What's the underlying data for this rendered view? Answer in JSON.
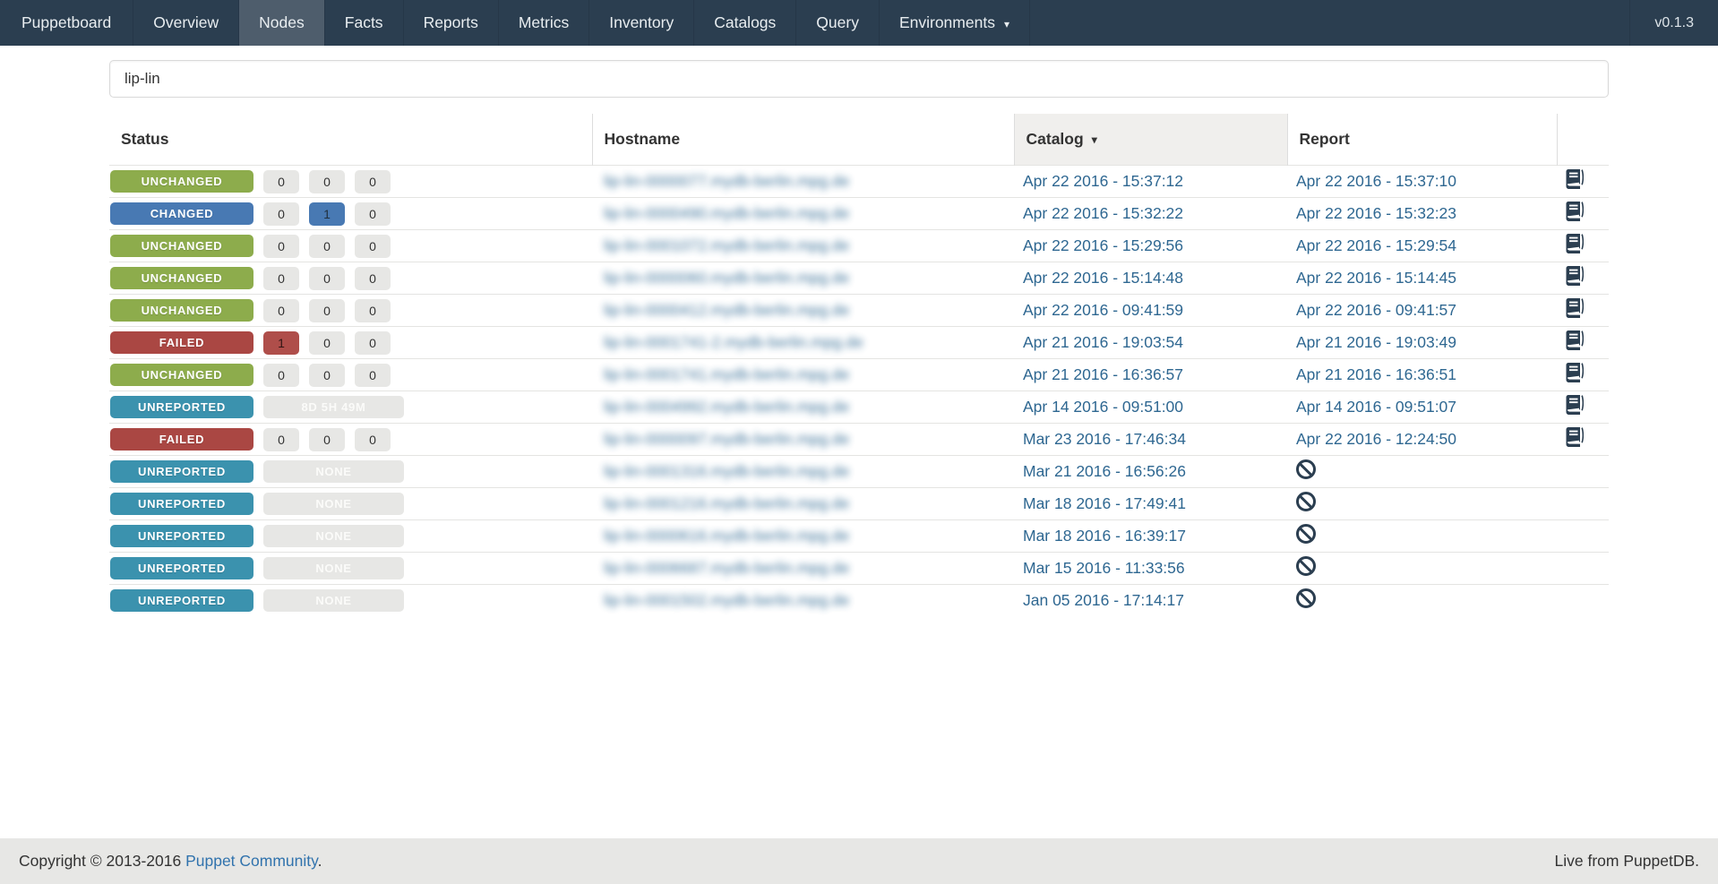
{
  "navbar": {
    "brand": "Puppetboard",
    "items": [
      {
        "label": "Overview",
        "active": false,
        "dropdown": false
      },
      {
        "label": "Nodes",
        "active": true,
        "dropdown": false
      },
      {
        "label": "Facts",
        "active": false,
        "dropdown": false
      },
      {
        "label": "Reports",
        "active": false,
        "dropdown": false
      },
      {
        "label": "Metrics",
        "active": false,
        "dropdown": false
      },
      {
        "label": "Inventory",
        "active": false,
        "dropdown": false
      },
      {
        "label": "Catalogs",
        "active": false,
        "dropdown": false
      },
      {
        "label": "Query",
        "active": false,
        "dropdown": false
      },
      {
        "label": "Environments",
        "active": false,
        "dropdown": true
      }
    ],
    "version": "v0.1.3"
  },
  "icons": {
    "dropdown_caret": "▾",
    "sort_caret": "▾"
  },
  "search": {
    "value": "lip-lin"
  },
  "table": {
    "headers": {
      "status": "Status",
      "hostname": "Hostname",
      "catalog": "Catalog",
      "report": "Report"
    },
    "sorted_column": "catalog",
    "sort_direction": "desc",
    "hostnames_blurred": true,
    "rows": [
      {
        "status": "UNCHANGED",
        "variant": "green",
        "counts": [
          {
            "v": "0",
            "hl": ""
          },
          {
            "v": "0",
            "hl": ""
          },
          {
            "v": "0",
            "hl": ""
          }
        ],
        "hostname": "lip-lin-0000077.mydb-berlin.mpg.de",
        "catalog": "Apr 22 2016 - 15:37:12",
        "report": "Apr 22 2016 - 15:37:10",
        "report_icon": "book"
      },
      {
        "status": "CHANGED",
        "variant": "blue",
        "counts": [
          {
            "v": "0",
            "hl": ""
          },
          {
            "v": "1",
            "hl": "hl-blue"
          },
          {
            "v": "0",
            "hl": ""
          }
        ],
        "hostname": "lip-lin-0000490.mydb-berlin.mpg.de",
        "catalog": "Apr 22 2016 - 15:32:22",
        "report": "Apr 22 2016 - 15:32:23",
        "report_icon": "book"
      },
      {
        "status": "UNCHANGED",
        "variant": "green",
        "counts": [
          {
            "v": "0",
            "hl": ""
          },
          {
            "v": "0",
            "hl": ""
          },
          {
            "v": "0",
            "hl": ""
          }
        ],
        "hostname": "lip-lin-0001072.mydb-berlin.mpg.de",
        "catalog": "Apr 22 2016 - 15:29:56",
        "report": "Apr 22 2016 - 15:29:54",
        "report_icon": "book"
      },
      {
        "status": "UNCHANGED",
        "variant": "green",
        "counts": [
          {
            "v": "0",
            "hl": ""
          },
          {
            "v": "0",
            "hl": ""
          },
          {
            "v": "0",
            "hl": ""
          }
        ],
        "hostname": "lip-lin-0000060.mydb-berlin.mpg.de",
        "catalog": "Apr 22 2016 - 15:14:48",
        "report": "Apr 22 2016 - 15:14:45",
        "report_icon": "book"
      },
      {
        "status": "UNCHANGED",
        "variant": "green",
        "counts": [
          {
            "v": "0",
            "hl": ""
          },
          {
            "v": "0",
            "hl": ""
          },
          {
            "v": "0",
            "hl": ""
          }
        ],
        "hostname": "lip-lin-0000412.mydb-berlin.mpg.de",
        "catalog": "Apr 22 2016 - 09:41:59",
        "report": "Apr 22 2016 - 09:41:57",
        "report_icon": "book"
      },
      {
        "status": "FAILED",
        "variant": "red",
        "counts": [
          {
            "v": "1",
            "hl": "hl-red"
          },
          {
            "v": "0",
            "hl": ""
          },
          {
            "v": "0",
            "hl": ""
          }
        ],
        "hostname": "lip-lin-0001741-2.mydb-berlin.mpg.de",
        "catalog": "Apr 21 2016 - 19:03:54",
        "report": "Apr 21 2016 - 19:03:49",
        "report_icon": "book"
      },
      {
        "status": "UNCHANGED",
        "variant": "green",
        "counts": [
          {
            "v": "0",
            "hl": ""
          },
          {
            "v": "0",
            "hl": ""
          },
          {
            "v": "0",
            "hl": ""
          }
        ],
        "hostname": "lip-lin-0001741.mydb-berlin.mpg.de",
        "catalog": "Apr 21 2016 - 16:36:57",
        "report": "Apr 21 2016 - 16:36:51",
        "report_icon": "book"
      },
      {
        "status": "UNREPORTED",
        "variant": "teal",
        "wide": "8D 5H 49M",
        "hostname": "lip-lin-0004992.mydb-berlin.mpg.de",
        "catalog": "Apr 14 2016 - 09:51:00",
        "report": "Apr 14 2016 - 09:51:07",
        "report_icon": "book"
      },
      {
        "status": "FAILED",
        "variant": "red",
        "counts": [
          {
            "v": "0",
            "hl": ""
          },
          {
            "v": "0",
            "hl": ""
          },
          {
            "v": "0",
            "hl": ""
          }
        ],
        "hostname": "lip-lin-0000097.mydb-berlin.mpg.de",
        "catalog": "Mar 23 2016 - 17:46:34",
        "report": "Apr 22 2016 - 12:24:50",
        "report_icon": "book"
      },
      {
        "status": "UNREPORTED",
        "variant": "teal",
        "wide": "NONE",
        "hostname": "lip-lin-0001316.mydb-berlin.mpg.de",
        "catalog": "Mar 21 2016 - 16:56:26",
        "report": "",
        "report_icon": "ban"
      },
      {
        "status": "UNREPORTED",
        "variant": "teal",
        "wide": "NONE",
        "hostname": "lip-lin-0001216.mydb-berlin.mpg.de",
        "catalog": "Mar 18 2016 - 17:49:41",
        "report": "",
        "report_icon": "ban"
      },
      {
        "status": "UNREPORTED",
        "variant": "teal",
        "wide": "NONE",
        "hostname": "lip-lin-0000616.mydb-berlin.mpg.de",
        "catalog": "Mar 18 2016 - 16:39:17",
        "report": "",
        "report_icon": "ban"
      },
      {
        "status": "UNREPORTED",
        "variant": "teal",
        "wide": "NONE",
        "hostname": "lip-lin-0006687.mydb-berlin.mpg.de",
        "catalog": "Mar 15 2016 - 11:33:56",
        "report": "",
        "report_icon": "ban"
      },
      {
        "status": "UNREPORTED",
        "variant": "teal",
        "wide": "NONE",
        "hostname": "lip-lin-0001502.mydb-berlin.mpg.de",
        "catalog": "Jan 05 2016 - 17:14:17",
        "report": "",
        "report_icon": "ban"
      }
    ]
  },
  "footer": {
    "copyright_prefix": "Copyright © 2013-2016 ",
    "community_link": "Puppet Community",
    "copyright_suffix": ".",
    "live_text": "Live from PuppetDB."
  },
  "colors": {
    "navbar_bg": "#2b3e50",
    "navbar_active_bg": "#4e5d6c",
    "badge_unchanged": "#8dac4c",
    "badge_changed": "#4879b3",
    "badge_failed": "#aa4743",
    "badge_unreported": "#3b92ae",
    "count_bg": "#e7e7e5",
    "link": "#2e6791",
    "footer_bg": "#e7e7e5",
    "sorted_header_bg": "#f0efed",
    "icon": "#2b3e50"
  }
}
